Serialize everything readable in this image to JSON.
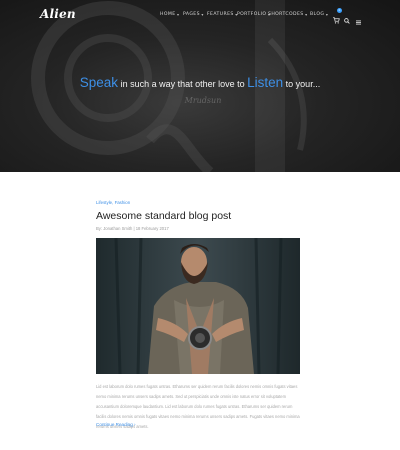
{
  "brand": {
    "logo_text": "Alien"
  },
  "nav": {
    "items": [
      {
        "label": "HOME"
      },
      {
        "label": "PAGES"
      },
      {
        "label": "FEATURES"
      },
      {
        "label": "PORTFOLIO"
      },
      {
        "label": "SHORTCODES"
      },
      {
        "label": "BLOG"
      }
    ],
    "cart_count": "0",
    "icons": [
      "cart-icon",
      "search-icon",
      "hamburger-icon"
    ]
  },
  "hero": {
    "quote_word1": "Speak",
    "quote_mid": " in such a way that other love to ",
    "quote_word2": "Listen",
    "quote_end": " to your...",
    "signature": "Mrudsun"
  },
  "post": {
    "categories": [
      "Lifestyle",
      "Fashion"
    ],
    "category_separator": ", ",
    "title": "Awesome standard blog post",
    "meta": "By: Jonathan Smith | 18 February 2017",
    "excerpt": "Lid est laborum dolo rumes fugats untras. Etharums ser quidem rerum facilis dolores nemis omnis fugats vitaes nemo minima rerums unsers sadips amets. Sed ut perspiciatis unde omnis iste natus error sit voluptatem accusantium doloremque laudantium. Lid est laborum dolo rumes fugats untras. Etharums ser quidem rerum facilis dolores nemis omnis fugats vitaes nemo minima rerums unsers sadips amets. Fugats vitaes nemo minima rerums unsers sadips amets.",
    "read_more": "Continue Reading ›"
  },
  "colors": {
    "accent": "#3d8fe6",
    "hero_bg": "#1c1c1c",
    "text_dark": "#222222",
    "text_muted": "#a8a8a8"
  }
}
